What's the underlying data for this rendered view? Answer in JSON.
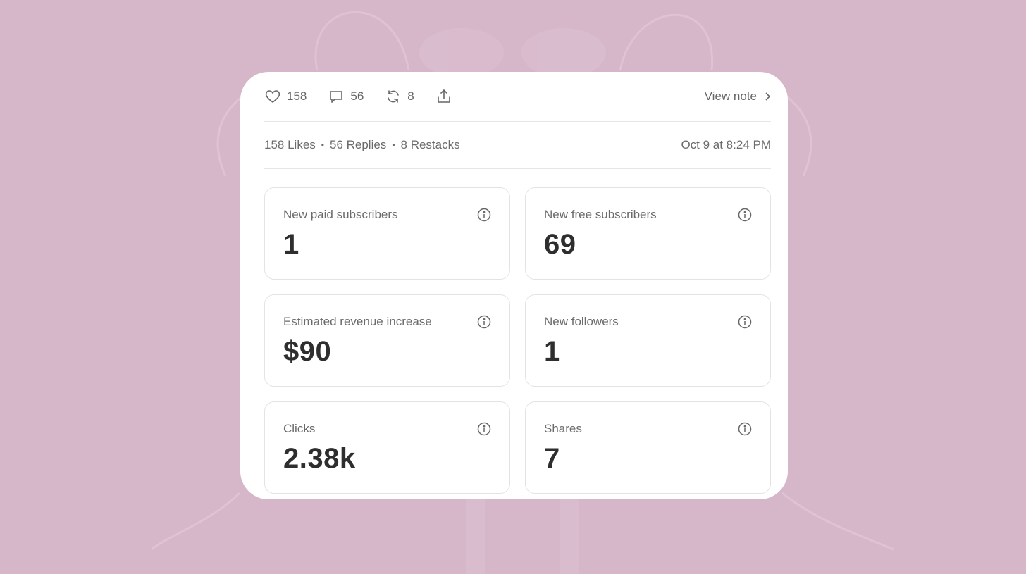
{
  "toolbar": {
    "likes_count": "158",
    "replies_count": "56",
    "restacks_count": "8",
    "view_note_label": "View note"
  },
  "summary": {
    "likes": "158 Likes",
    "replies": "56 Replies",
    "restacks": "8 Restacks",
    "separator": "•",
    "timestamp": "Oct 9 at 8:24 PM"
  },
  "stats": [
    {
      "label": "New paid subscribers",
      "value": "1"
    },
    {
      "label": "New free subscribers",
      "value": "69"
    },
    {
      "label": "Estimated revenue increase",
      "value": "$90"
    },
    {
      "label": "New followers",
      "value": "1"
    },
    {
      "label": "Clicks",
      "value": "2.38k"
    },
    {
      "label": "Shares",
      "value": "7"
    }
  ],
  "icons": {
    "like": "heart-icon",
    "reply": "comment-icon",
    "restack": "restack-icon",
    "share": "share-icon",
    "chevron": "chevron-right-icon",
    "info": "info-icon"
  },
  "colors": {
    "background": "#d6b7ca",
    "card": "#ffffff",
    "text_muted": "#6b6b6b",
    "text_value": "#2e2e2e"
  }
}
